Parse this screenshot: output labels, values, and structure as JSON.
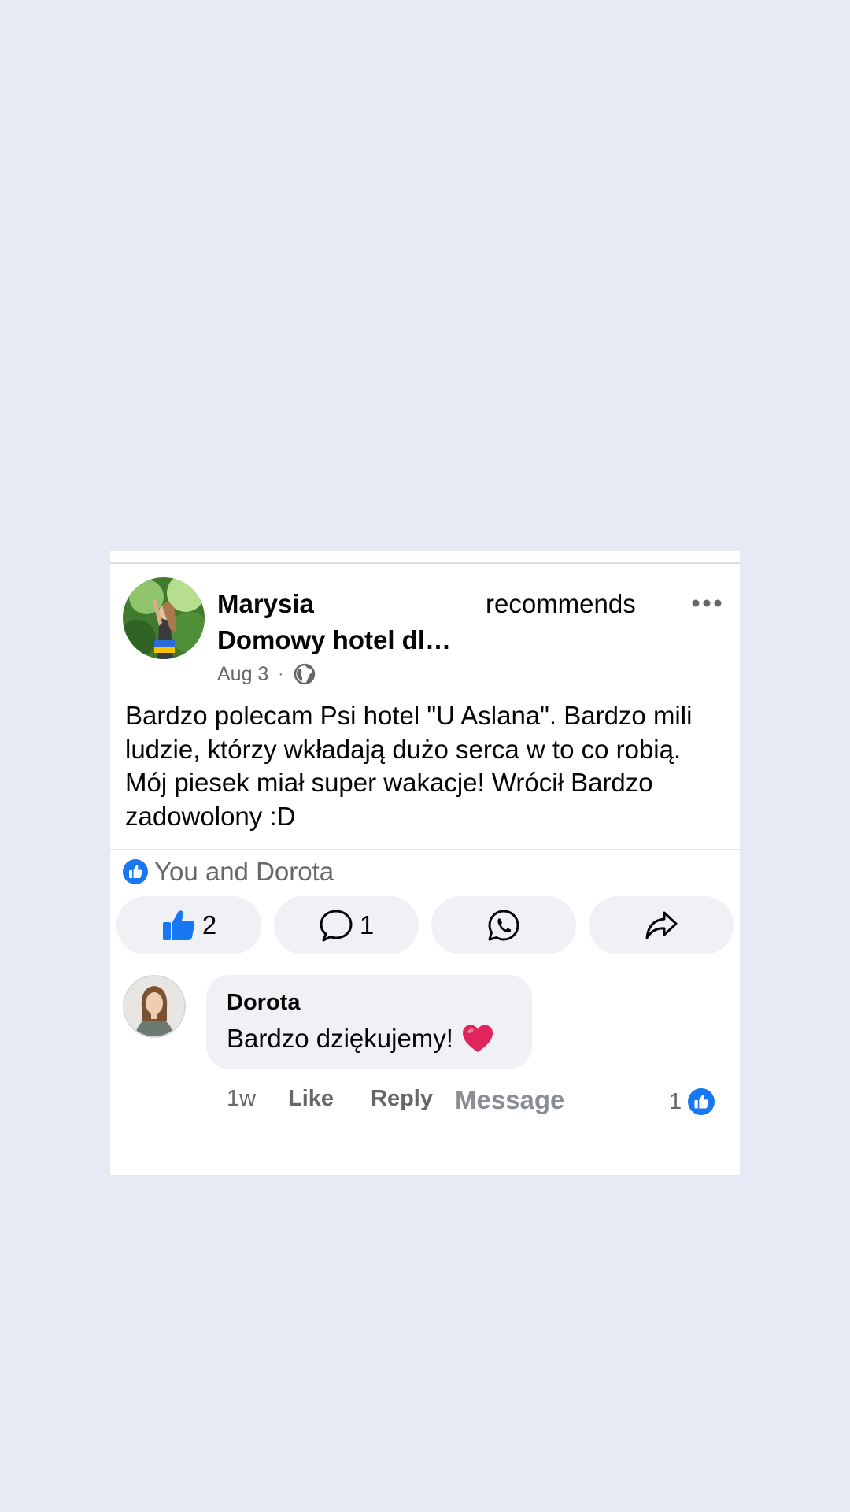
{
  "post": {
    "author": "Marysia",
    "action": "recommends",
    "page_name": "Domowy hotel dla psów",
    "date": "Aug 3",
    "separator": "·",
    "audience_icon": "globe-icon",
    "body": "Bardzo polecam Psi hotel \"U Aslana\". Bardzo mili ludzie, którzy wkładają dużo serca w to co robią. Mój piesek miał super wakacje! Wrócił Bardzo zadowolony :D",
    "reactions_summary": "You and Dorota",
    "like_count": "2",
    "comment_count": "1"
  },
  "comment": {
    "author": "Dorota",
    "text": "Bardzo dziękujemy!",
    "emoji": "heart",
    "time": "1w",
    "like_label": "Like",
    "reply_label": "Reply",
    "message_label": "Message",
    "like_count": "1"
  },
  "colors": {
    "background": "#e6eaf4",
    "card": "#ffffff",
    "brand_blue": "#1877f2",
    "pill": "#f0f1f5",
    "secondary_text": "#65676b",
    "heart": "#e0245e"
  }
}
